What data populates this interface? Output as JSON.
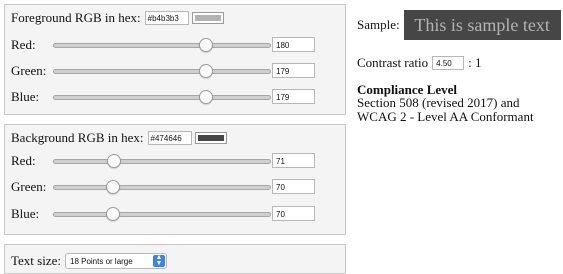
{
  "foreground": {
    "label": "Foreground RGB in hex:",
    "hex": "#b4b3b3",
    "swatch_color": "#b4b3b3",
    "channels": [
      {
        "label": "Red:",
        "value": "180",
        "level": 180
      },
      {
        "label": "Green:",
        "value": "179",
        "level": 179
      },
      {
        "label": "Blue:",
        "value": "179",
        "level": 179
      }
    ]
  },
  "background": {
    "label": "Background RGB in hex:",
    "hex": "#474646",
    "swatch_color": "#474646",
    "channels": [
      {
        "label": "Red:",
        "value": "71",
        "level": 71
      },
      {
        "label": "Green:",
        "value": "70",
        "level": 70
      },
      {
        "label": "Blue:",
        "value": "70",
        "level": 70
      }
    ]
  },
  "text_size": {
    "label": "Text size:",
    "selected": "18 Points or large",
    "arrows_icon": "select-arrows-icon"
  },
  "sample": {
    "label": "Sample:",
    "text": "This is sample text"
  },
  "contrast": {
    "label": "Contrast ratio",
    "value": "4.50",
    "suffix": ": 1"
  },
  "compliance": {
    "heading": "Compliance Level",
    "text": "Section 508 (revised 2017) and WCAG 2 - Level AA Conformant"
  },
  "slider_max": 255
}
